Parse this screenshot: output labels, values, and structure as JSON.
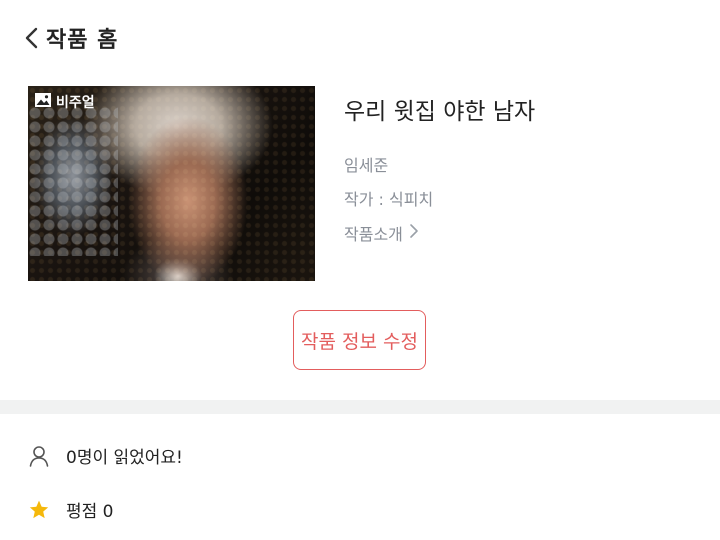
{
  "header": {
    "back_label": "작품 홈"
  },
  "work": {
    "badge_label": "비주얼",
    "title": "우리 윗집 야한 남자",
    "author": "임세준",
    "writer": "작가 : 식피치",
    "intro_label": "작품소개"
  },
  "actions": {
    "edit_label": "작품 정보 수정"
  },
  "stats": {
    "readers": "0명이 읽었어요!",
    "rating": "평점 0"
  },
  "colors": {
    "accent": "#e35d5d",
    "muted_text": "#8a8f98",
    "star": "#f5b80b",
    "divider": "#f1f2f2"
  },
  "icons": {
    "back": "chevron-left-icon",
    "badge": "image-icon",
    "intro": "chevron-right-icon",
    "readers": "user-icon",
    "rating": "star-icon"
  }
}
